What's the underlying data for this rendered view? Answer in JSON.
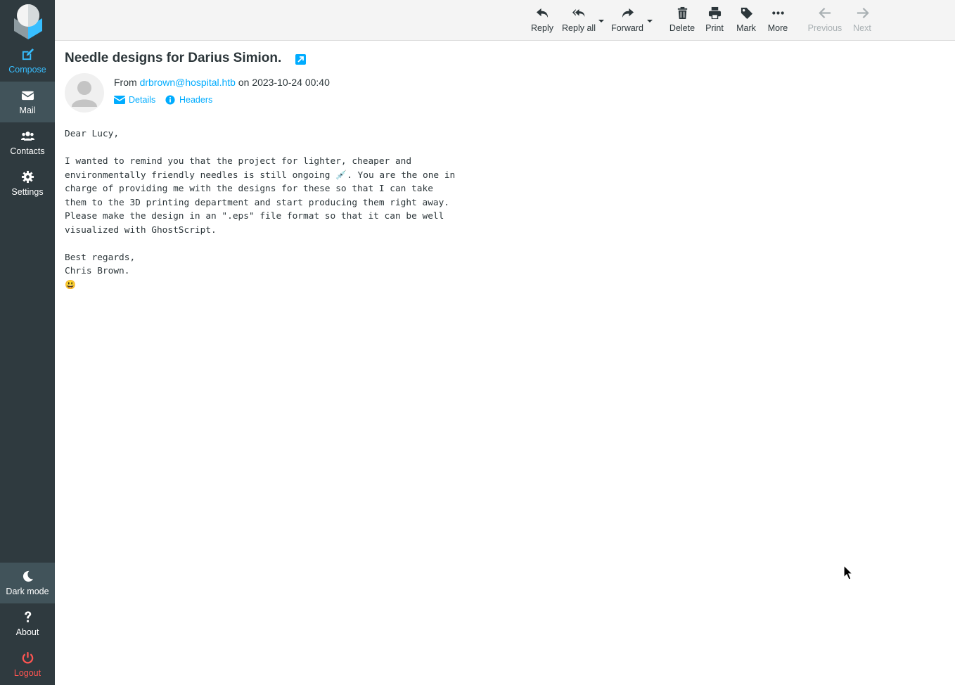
{
  "sidebar": {
    "compose": "Compose",
    "mail": "Mail",
    "contacts": "Contacts",
    "settings": "Settings",
    "dark_mode": "Dark mode",
    "about": "About",
    "logout": "Logout"
  },
  "toolbar": {
    "reply": "Reply",
    "reply_all": "Reply all",
    "forward": "Forward",
    "delete": "Delete",
    "print": "Print",
    "mark": "Mark",
    "more": "More",
    "previous": "Previous",
    "next": "Next"
  },
  "message": {
    "subject": "Needle designs for Darius Simion.",
    "from_prefix": "From",
    "from_email": "drbrown@hospital.htb",
    "date_prefix": "on",
    "date": "2023-10-24 00:40",
    "details_label": "Details",
    "headers_label": "Headers",
    "body": "Dear Lucy,\n\nI wanted to remind you that the project for lighter, cheaper and\nenvironmentally friendly needles is still ongoing 💉. You are the one in\ncharge of providing me with the designs for these so that I can take\nthem to the 3D printing department and start producing them right away.\nPlease make the design in an \".eps\" file format so that it can be well\nvisualized with GhostScript.\n\nBest regards,\nChris Brown.\n😃"
  },
  "colors": {
    "sidebar_bg": "#2f3a3f",
    "accent": "#00acff",
    "logout": "#ff5552"
  }
}
